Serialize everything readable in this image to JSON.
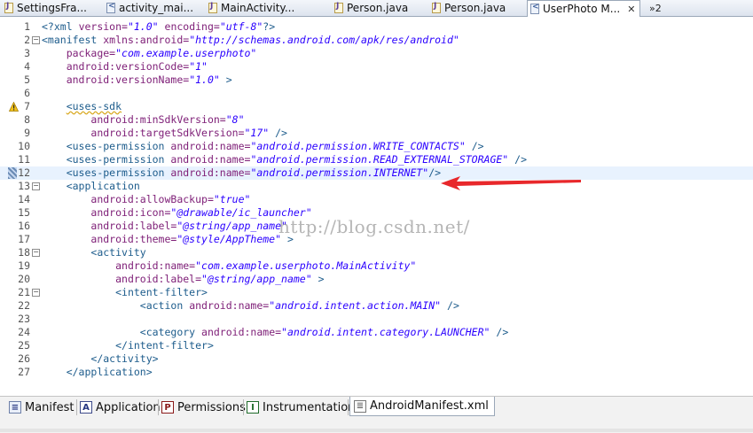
{
  "editor_tabs": [
    {
      "label": "SettingsFra...",
      "icon": "java-file-icon"
    },
    {
      "label": "activity_mai...",
      "icon": "xml-file-icon"
    },
    {
      "label": "MainActivity...",
      "icon": "java-file-icon"
    },
    {
      "label": "Person.java",
      "icon": "java-file-icon"
    },
    {
      "label": "Person.java",
      "icon": "java-file-icon"
    },
    {
      "label": "UserPhoto M...",
      "icon": "manifest-file-icon",
      "active": true
    }
  ],
  "tab_close": "✕",
  "tab_overflow": "»2",
  "code_lines": [
    {
      "n": "1",
      "text": "<?xml version=\"1.0\" encoding=\"utf-8\"?>"
    },
    {
      "n": "2",
      "text": "<manifest xmlns:android=\"http://schemas.android.com/apk/res/android\""
    },
    {
      "n": "3",
      "text": "    package=\"com.example.userphoto\""
    },
    {
      "n": "4",
      "text": "    android:versionCode=\"1\""
    },
    {
      "n": "5",
      "text": "    android:versionName=\"1.0\" >"
    },
    {
      "n": "6",
      "text": ""
    },
    {
      "n": "7",
      "text": "    <uses-sdk"
    },
    {
      "n": "8",
      "text": "        android:minSdkVersion=\"8\""
    },
    {
      "n": "9",
      "text": "        android:targetSdkVersion=\"17\" />"
    },
    {
      "n": "10",
      "text": "    <uses-permission android:name=\"android.permission.WRITE_CONTACTS\" />"
    },
    {
      "n": "11",
      "text": "    <uses-permission android:name=\"android.permission.READ_EXTERNAL_STORAGE\" />"
    },
    {
      "n": "12",
      "text": "    <uses-permission android:name=\"android.permission.INTERNET\"/>"
    },
    {
      "n": "13",
      "text": "    <application"
    },
    {
      "n": "14",
      "text": "        android:allowBackup=\"true\""
    },
    {
      "n": "15",
      "text": "        android:icon=\"@drawable/ic_launcher\""
    },
    {
      "n": "16",
      "text": "        android:label=\"@string/app_name\""
    },
    {
      "n": "17",
      "text": "        android:theme=\"@style/AppTheme\" >"
    },
    {
      "n": "18",
      "text": "        <activity"
    },
    {
      "n": "19",
      "text": "            android:name=\"com.example.userphoto.MainActivity\""
    },
    {
      "n": "20",
      "text": "            android:label=\"@string/app_name\" >"
    },
    {
      "n": "21",
      "text": "            <intent-filter>"
    },
    {
      "n": "22",
      "text": "                <action android:name=\"android.intent.action.MAIN\" />"
    },
    {
      "n": "23",
      "text": ""
    },
    {
      "n": "24",
      "text": "                <category android:name=\"android.intent.category.LAUNCHER\" />"
    },
    {
      "n": "25",
      "text": "            </intent-filter>"
    },
    {
      "n": "26",
      "text": "        </activity>"
    },
    {
      "n": "27",
      "text": "    </application>"
    }
  ],
  "current_line": "12",
  "warning_line": "7",
  "fold_lines": [
    "2",
    "13",
    "18",
    "21"
  ],
  "watermark": "http://blog.csdn.net/",
  "arrow_color": "#e8282b",
  "bottom_tabs": [
    {
      "label": "Manifest",
      "icon": "manifest-overview-icon"
    },
    {
      "label": "Application",
      "icon": "application-icon",
      "glyph": "A"
    },
    {
      "label": "Permissions",
      "icon": "permissions-icon",
      "glyph": "P"
    },
    {
      "label": "Instrumentation",
      "icon": "instrumentation-icon",
      "glyph": "I"
    },
    {
      "label": "AndroidManifest.xml",
      "icon": "xml-source-icon",
      "active": true
    }
  ]
}
